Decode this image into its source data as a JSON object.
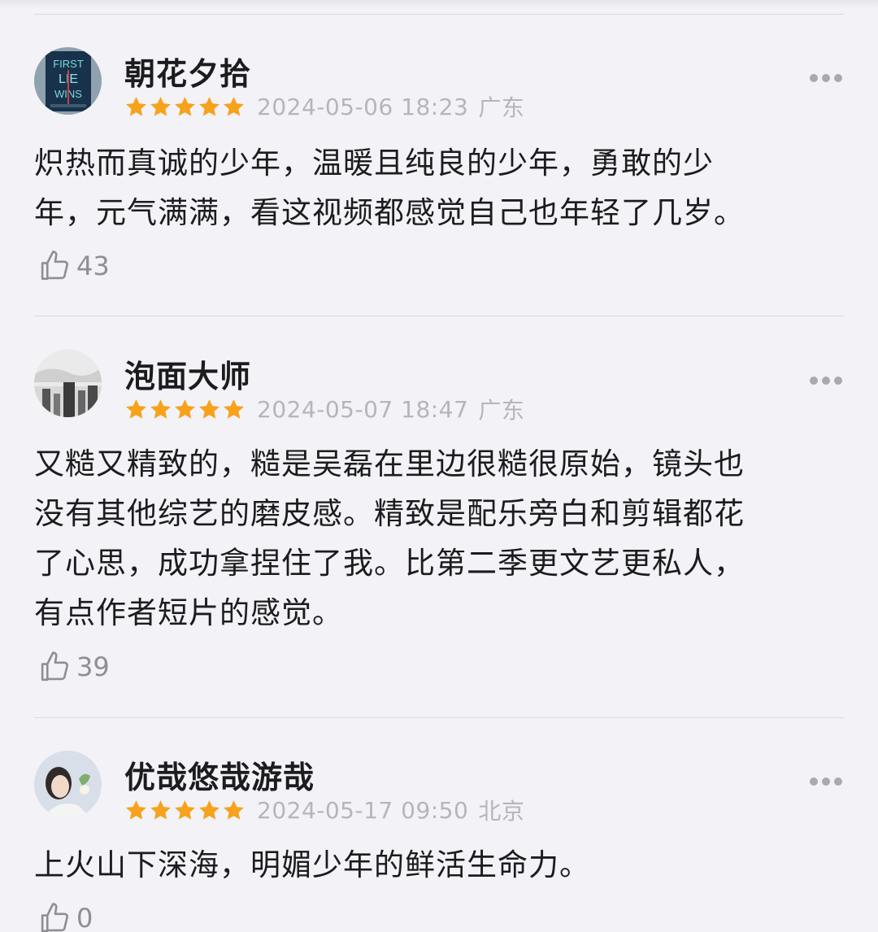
{
  "reviews": [
    {
      "username": "朝花夕拾",
      "date": "2024-05-06 18:23",
      "location": "广东",
      "rating": 5,
      "text_lines": [
        "炽热而真诚的少年，温暖且纯良的少年，勇敢的少",
        "年，元气满满，看这视频都感觉自己也年轻了几岁。"
      ],
      "likes": "43",
      "avatar_text": [
        "FIRST",
        "LIE",
        "WINS"
      ]
    },
    {
      "username": "泡面大师",
      "date": "2024-05-07 18:47",
      "location": "广东",
      "rating": 5,
      "text_lines": [
        "又糙又精致的，糙是吴磊在里边很糙很原始，镜头也",
        "没有其他综艺的磨皮感。精致是配乐旁白和剪辑都花",
        "了心思，成功拿捏住了我。比第二季更文艺更私人，",
        "有点作者短片的感觉。"
      ],
      "likes": "39"
    },
    {
      "username": "优哉悠哉游哉",
      "date": "2024-05-17 09:50",
      "location": "北京",
      "rating": 5,
      "text_lines": [
        "上火山下深海，明媚少年的鲜活生命力。"
      ],
      "likes": "0"
    }
  ],
  "icons": {
    "star": "star-icon",
    "thumb": "thumbs-up-icon",
    "more": "more-icon"
  },
  "colors": {
    "star": "#f7a21b",
    "background": "#f2f2f7",
    "meta_text": "#b5b5ba"
  }
}
